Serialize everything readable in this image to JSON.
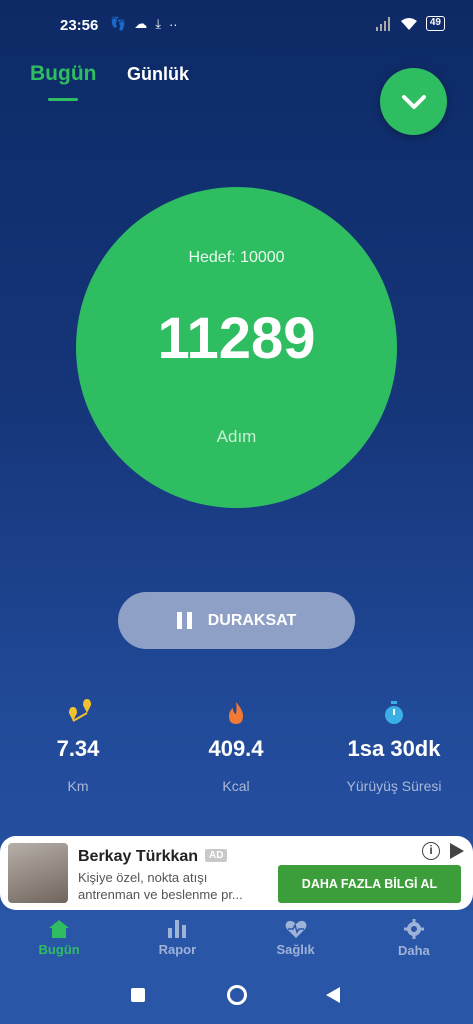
{
  "status_bar": {
    "time": "23:56",
    "battery": "49"
  },
  "tabs": {
    "today": "Bugün",
    "daily": "Günlük"
  },
  "steps": {
    "goal": "Hedef: 10000",
    "value": "11289",
    "unit": "Adım"
  },
  "pause_button": {
    "label": "DURAKSAT"
  },
  "stats": {
    "distance": {
      "value": "7.34",
      "label": "Km",
      "icon": "map-pin-icon"
    },
    "calories": {
      "value": "409.4",
      "label": "Kcal",
      "icon": "flame-icon"
    },
    "duration": {
      "value": "1sa 30dk",
      "label": "Yürüyüş Süresi",
      "icon": "stopwatch-icon"
    }
  },
  "ad": {
    "title": "Berkay Türkkan",
    "badge": "AD",
    "description": "Kişiye özel, nokta atışı antrenman ve beslenme pr...",
    "cta": "DAHA FAZLA BİLGİ AL"
  },
  "bottom_nav": {
    "items": [
      {
        "label": "Bugün",
        "icon": "home-icon",
        "active": true
      },
      {
        "label": "Rapor",
        "icon": "bar-chart-icon",
        "active": false
      },
      {
        "label": "Sağlık",
        "icon": "heart-icon",
        "active": false
      },
      {
        "label": "Daha",
        "icon": "gear-icon",
        "active": false
      }
    ]
  },
  "colors": {
    "accent": "#2fbd62",
    "background_top": "#0d2a66",
    "background_bottom": "#2a56a8"
  }
}
